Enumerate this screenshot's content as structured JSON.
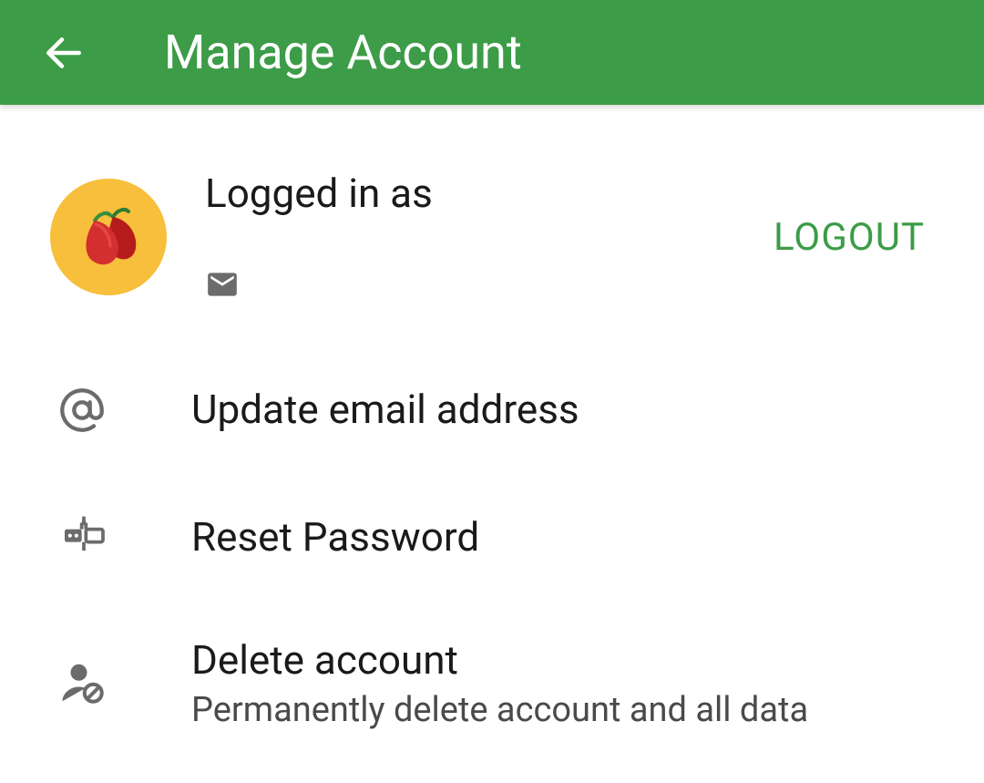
{
  "header": {
    "title": "Manage Account"
  },
  "account": {
    "logged_in_label": "Logged in as",
    "logout_label": "LOGOUT"
  },
  "items": {
    "update_email": {
      "title": "Update email address"
    },
    "reset_password": {
      "title": "Reset Password"
    },
    "delete_account": {
      "title": "Delete account",
      "subtitle": "Permanently delete account and all data"
    }
  },
  "colors": {
    "primary": "#3c9c47",
    "avatar_bg": "#f7bf3b",
    "icon": "#6b6b6b",
    "text_primary": "#1a1a1a",
    "text_secondary": "#4a4a4a"
  },
  "icons": {
    "back": "arrow-back",
    "avatar": "chili-peppers",
    "email": "email",
    "update_email": "at-sign",
    "reset_password": "password-key",
    "delete_account": "person-remove"
  }
}
